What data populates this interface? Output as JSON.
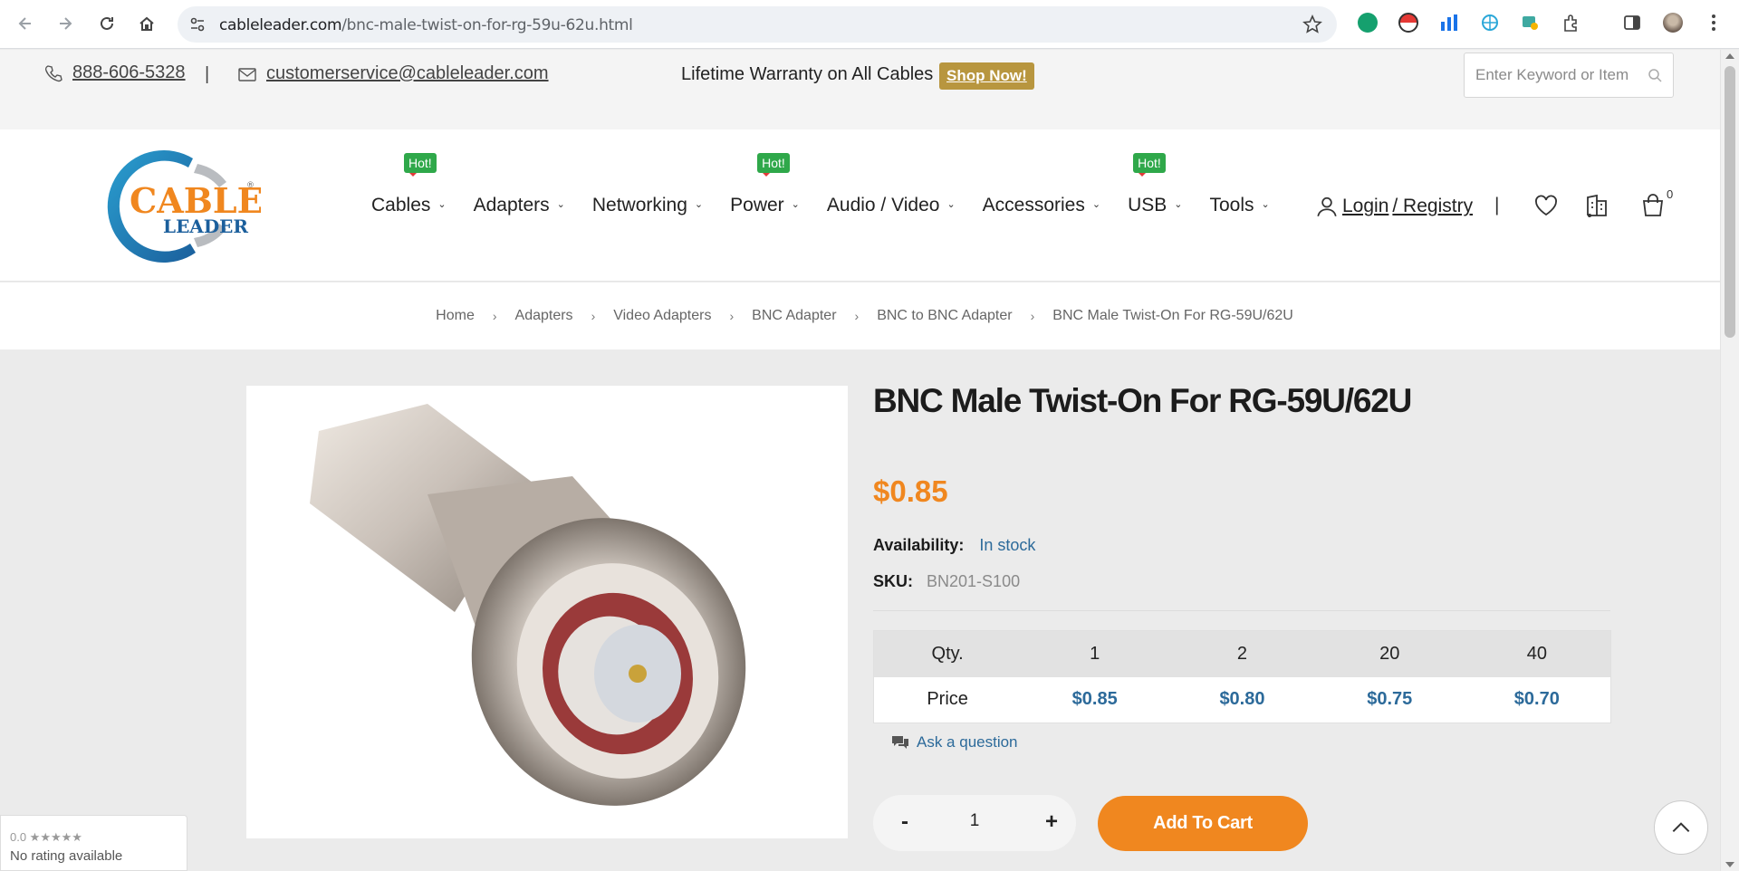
{
  "browser": {
    "url_host": "cableleader.com",
    "url_path": "/bnc-male-twist-on-for-rg-59u-62u.html"
  },
  "topbar": {
    "phone": "888-606-5328",
    "separator": "|",
    "email": "customerservice@cableleader.com",
    "promo": "Lifetime Warranty on All Cables",
    "shop_now": "Shop Now!",
    "search_placeholder": "Enter Keyword or Item"
  },
  "logo": {
    "line1": "CABLE",
    "line2": "LEADER",
    "registered": "®"
  },
  "menu": [
    {
      "label": "Cables",
      "hot": "Hot!"
    },
    {
      "label": "Adapters",
      "hot": ""
    },
    {
      "label": "Networking",
      "hot": ""
    },
    {
      "label": "Power",
      "hot": "Hot!"
    },
    {
      "label": "Audio / Video",
      "hot": ""
    },
    {
      "label": "Accessories",
      "hot": ""
    },
    {
      "label": "USB",
      "hot": "Hot!"
    },
    {
      "label": "Tools",
      "hot": ""
    }
  ],
  "header": {
    "login": "Login",
    "registry": " / Registry",
    "separator": "|",
    "cart_count": "0"
  },
  "breadcrumb": [
    "Home",
    "Adapters",
    "Video Adapters",
    "BNC Adapter",
    "BNC to BNC Adapter",
    "BNC Male Twist-On For RG-59U/62U"
  ],
  "product": {
    "title": "BNC Male Twist-On For RG-59U/62U",
    "price": "$0.85",
    "availability_label": "Availability:",
    "availability_value": "In stock",
    "sku_label": "SKU:",
    "sku_value": "BN201-S100",
    "tier_table": {
      "qty_label": "Qty.",
      "price_label": "Price",
      "quantities": [
        "1",
        "2",
        "20",
        "40"
      ],
      "prices": [
        "$0.85",
        "$0.80",
        "$0.75",
        "$0.70"
      ]
    },
    "ask_question": "Ask a question",
    "quantity": "1",
    "minus": "-",
    "plus": "+",
    "add_to_cart": "Add To Cart"
  },
  "rating_widget": {
    "score": "0.0 ★★★★★",
    "text": "No rating available"
  },
  "colors": {
    "accent_orange": "#f0871f",
    "link_blue": "#2c6a9a",
    "hot_green": "#2fa84a",
    "shop_gold": "#b8963f"
  }
}
